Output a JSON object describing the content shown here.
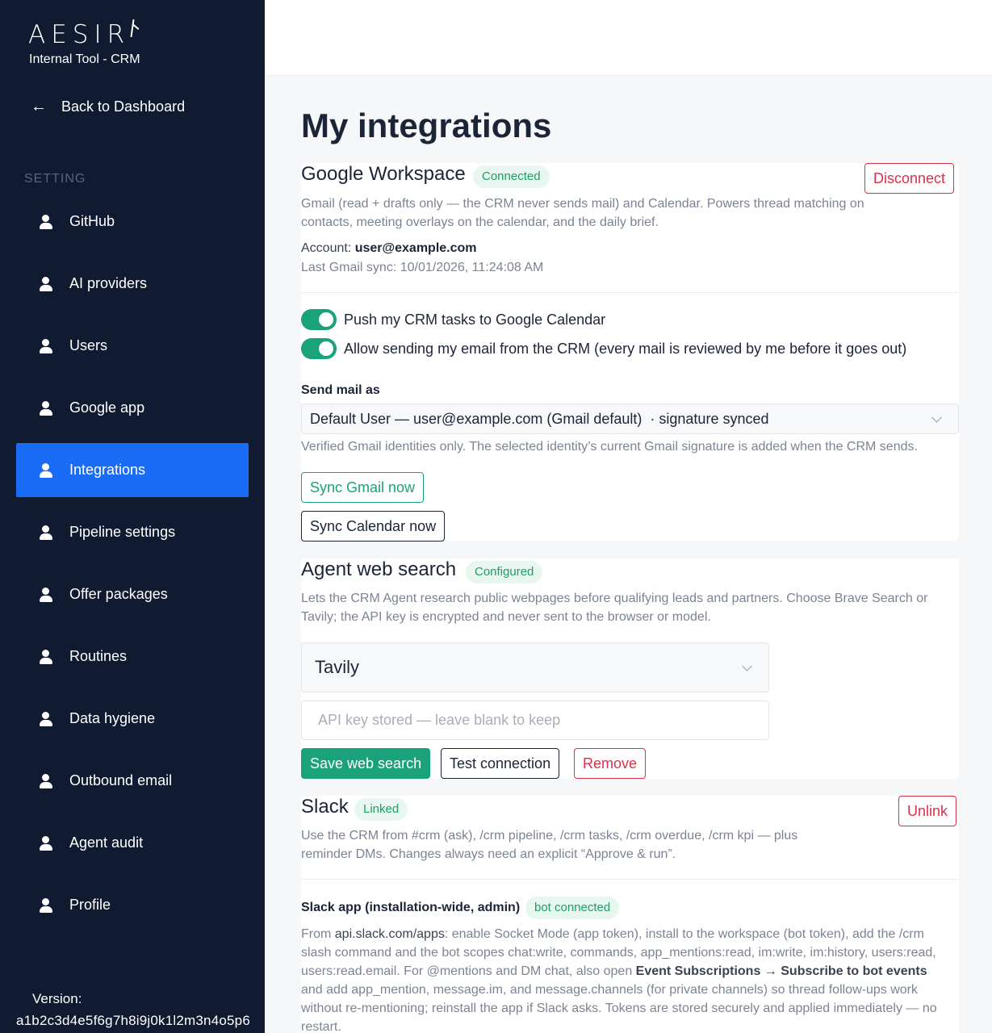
{
  "sidebar": {
    "logo": "AESIR",
    "tool_name": "Internal Tool - CRM",
    "back_label": "Back to Dashboard",
    "section_label": "SETTING",
    "items": [
      {
        "label": "GitHub",
        "active": false
      },
      {
        "label": "AI providers",
        "active": false
      },
      {
        "label": "Users",
        "active": false
      },
      {
        "label": "Google app",
        "active": false
      },
      {
        "label": "Integrations",
        "active": true
      },
      {
        "label": "Pipeline settings",
        "active": false
      },
      {
        "label": "Offer packages",
        "active": false
      },
      {
        "label": "Routines",
        "active": false
      },
      {
        "label": "Data hygiene",
        "active": false
      },
      {
        "label": "Outbound email",
        "active": false
      },
      {
        "label": "Agent audit",
        "active": false
      },
      {
        "label": "Profile",
        "active": false
      }
    ],
    "version_label": "Version:",
    "version_value": "a1b2c3d4e5f6g7h8i9j0k1l2m3n4o5p6"
  },
  "page_title": "My integrations",
  "google_workspace": {
    "title": "Google Workspace",
    "badge": "Connected",
    "disconnect_label": "Disconnect",
    "description": "Gmail (read + drafts only — the CRM never sends mail) and Calendar. Powers thread matching on contacts, meeting overlays on the calendar, and the daily brief.",
    "account_label": "Account:",
    "account_value": "user@example.com",
    "last_sync": "Last Gmail sync: 10/01/2026, 11:24:08 AM",
    "toggle_calendar": "Push my CRM tasks to Google Calendar",
    "toggle_send": "Allow sending my email from the CRM (every mail is reviewed by me before it goes out)",
    "send_as_label": "Send mail as",
    "send_as_value": "Default User — user@example.com (Gmail default)  · signature synced",
    "send_as_help": "Verified Gmail identities only. The selected identity’s current Gmail signature is added when the CRM sends.",
    "sync_gmail_label": "Sync Gmail now",
    "sync_calendar_label": "Sync Calendar now"
  },
  "web_search": {
    "title": "Agent web search",
    "badge": "Configured",
    "description": "Lets the CRM Agent research public webpages before qualifying leads and partners. Choose Brave Search or Tavily; the API key is encrypted and never sent to the browser or model.",
    "provider_value": "Tavily",
    "api_key_placeholder": "API key stored — leave blank to keep",
    "save_label": "Save web search",
    "test_label": "Test connection",
    "remove_label": "Remove"
  },
  "slack": {
    "title": "Slack",
    "badge": "Linked",
    "unlink_label": "Unlink",
    "description": "Use the CRM from #crm (ask), /crm pipeline, /crm tasks, /crm overdue, /crm kpi — plus reminder DMs. Changes always need an explicit “Approve & run”.",
    "app_label": "Slack app (installation-wide, admin)",
    "app_badge": "bot connected",
    "app_desc_1": "From ",
    "app_desc_link": "api.slack.com/apps",
    "app_desc_2": ": enable Socket Mode (app token), install to the workspace (bot token), add the /crm slash command and the bot scopes chat:write, commands, app_mentions:read, im:write, im:history, users:read, users:read.email. For @mentions and DM chat, also open ",
    "app_desc_bold": "Event Subscriptions → Subscribe to bot events",
    "app_desc_3": " and add app_mention, message.im, and message.channels (for private channels) so thread follow-ups work without re-mentioning; reinstall the app if Slack asks. Tokens are stored securely and applied immediately — no restart."
  },
  "colors": {
    "sidebar_bg": "#101a30",
    "active_nav": "#1a6cf5",
    "accent_green": "#1aa37a",
    "danger": "#d9304a"
  }
}
